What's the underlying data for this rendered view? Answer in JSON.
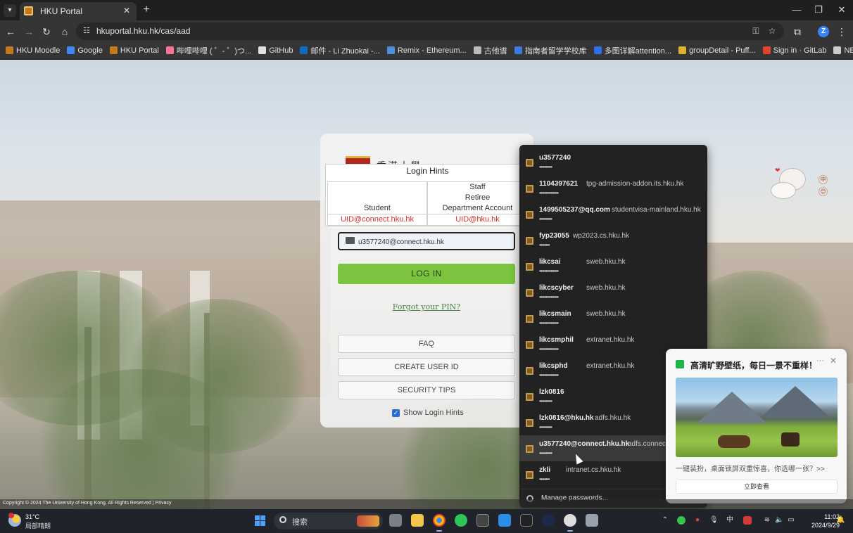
{
  "browser": {
    "tab": {
      "title": "HKU Portal"
    },
    "url": "hkuportal.hku.hk/cas/aad",
    "profile_initial": "Z",
    "bookmarks": [
      {
        "label": "HKU Moodle",
        "color": "#c47a1c"
      },
      {
        "label": "Google",
        "color": "#4285f4"
      },
      {
        "label": "HKU Portal",
        "color": "#c47a1c"
      },
      {
        "label": "哔哩哔哩 ( ゜- ゜)つ...",
        "color": "#fb7299"
      },
      {
        "label": "GitHub",
        "color": "#e0e0e0"
      },
      {
        "label": "邮件 - Li Zhuokai -...",
        "color": "#0f6cbd"
      },
      {
        "label": "Remix - Ethereum...",
        "color": "#4a90d9"
      },
      {
        "label": "古他谱",
        "color": "#bbbbbb"
      },
      {
        "label": "指南者留学学校库",
        "color": "#3d7be0"
      },
      {
        "label": "多图详解attention...",
        "color": "#2f6fe8"
      },
      {
        "label": "groupDetail - Puff...",
        "color": "#e0b030"
      },
      {
        "label": "Sign in · GitLab",
        "color": "#e2432a"
      },
      {
        "label": "NETjobs",
        "color": "#cccccc"
      }
    ]
  },
  "login": {
    "university_name": "香港大學",
    "hints": {
      "title": "Login Hints",
      "student_header": "Student",
      "staff_header_1": "Staff",
      "staff_header_2": "Retiree",
      "staff_header_3": "Department Account",
      "student_value": "UID@connect.hku.hk",
      "staff_value": "UID@hku.hk"
    },
    "username_value": "u3577240@connect.hku.hk",
    "login_button": "LOG IN",
    "forgot_link": "Forgot your PIN?",
    "faq_button": "FAQ",
    "create_button": "CREATE USER ID",
    "security_button": "SECURITY TIPS",
    "show_hints_label": "Show Login Hints",
    "show_hints_checked": true
  },
  "password_dropdown": {
    "entries": [
      {
        "user": "u3577240",
        "site": "",
        "dots": "••••••••••"
      },
      {
        "user": "1104397621",
        "site": "tpg-admission-addon.its.hku.hk",
        "dots": "•••••••••••••••"
      },
      {
        "user": "1499505237@qq.com",
        "site": "studentvisa-mainland.hku.hk",
        "dots": "••••••••••"
      },
      {
        "user": "fyp23055",
        "site": "wp2023.cs.hku.hk",
        "dots": "••••••••"
      },
      {
        "user": "likcsai",
        "site": "sweb.hku.hk",
        "dots": "•••••••••••••••"
      },
      {
        "user": "likcscyber",
        "site": "sweb.hku.hk",
        "dots": "•••••••••••••••"
      },
      {
        "user": "likcsmain",
        "site": "sweb.hku.hk",
        "dots": "•••••••••••••••"
      },
      {
        "user": "likcsmphil",
        "site": "extranet.hku.hk",
        "dots": "•••••••••••••••"
      },
      {
        "user": "likcsphd",
        "site": "extranet.hku.hk",
        "dots": "•••••••••••••••"
      },
      {
        "user": "lzk0816",
        "site": "",
        "dots": "••••••••••"
      },
      {
        "user": "lzk0816@hku.hk",
        "site": "adfs.hku.hk",
        "dots": "••••••••••"
      },
      {
        "user": "u3577240@connect.hku.hk",
        "site": "adfs.connect",
        "dots": "••••••••••"
      },
      {
        "user": "zkli",
        "site": "intranet.cs.hku.hk",
        "dots": "••••••••"
      }
    ],
    "manage_label": "Manage passwords..."
  },
  "notification": {
    "title": "高清旷野壁纸，每日一景不重样！",
    "more": "···",
    "description": "一键装扮，桌面锁屏双重惊喜，你选哪一张？>>",
    "button": "立即查看"
  },
  "footer_text": "Copyright © 2024 The University of Hong Kong. All Rights Reserved | Privacy",
  "sticker": {
    "chip_1": "中",
    "chip_2": "😊"
  },
  "taskbar": {
    "weather_temp": "31°C",
    "weather_desc": "局部晴朗",
    "search_label": "搜索",
    "ime": "中",
    "time": "11:02",
    "date": "2024/9/29"
  }
}
